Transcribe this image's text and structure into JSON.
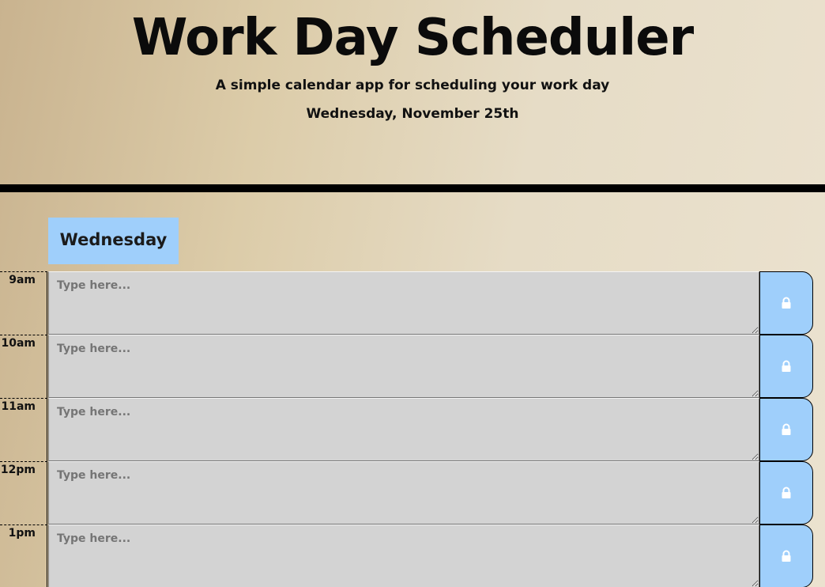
{
  "header": {
    "title": "Work Day Scheduler",
    "subtitle": "A simple calendar app for scheduling your work day",
    "current_day": "Wednesday, November 25th"
  },
  "day_label": "Wednesday",
  "placeholder": "Type here...",
  "colors": {
    "accent": "#9fcffb",
    "row_bg": "#d3d3d3"
  },
  "save_icon": "lock-icon",
  "rows": [
    {
      "hour": "9am"
    },
    {
      "hour": "10am"
    },
    {
      "hour": "11am"
    },
    {
      "hour": "12pm"
    },
    {
      "hour": "1pm"
    }
  ]
}
